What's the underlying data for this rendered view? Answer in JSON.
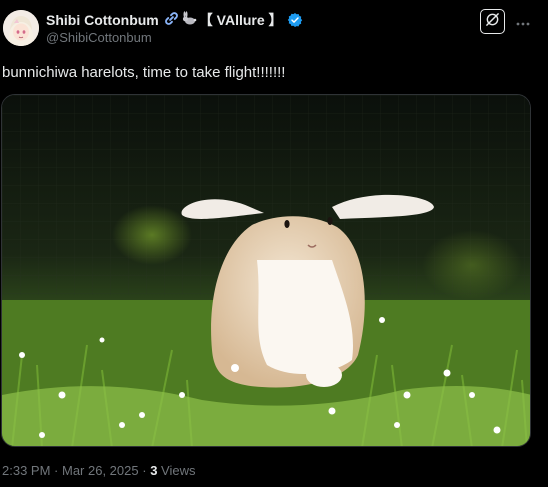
{
  "author": {
    "display_name": "Shibi Cottonbum",
    "tag": "【 VAllure 】",
    "handle": "@ShibiCottonbum",
    "verified_color": "#1d9bf0"
  },
  "tweet": {
    "text": "bunnichiwa harelots, time to take flight!!!!!!!",
    "time": "2:33 PM",
    "date": "Mar 26, 2025",
    "views_count": "3",
    "views_label": "Views"
  },
  "icons": {
    "grok": "grok-icon",
    "more": "more-icon",
    "link": "chain-link-icon",
    "rabbit": "rabbit-icon",
    "verified": "verified-badge-icon"
  }
}
